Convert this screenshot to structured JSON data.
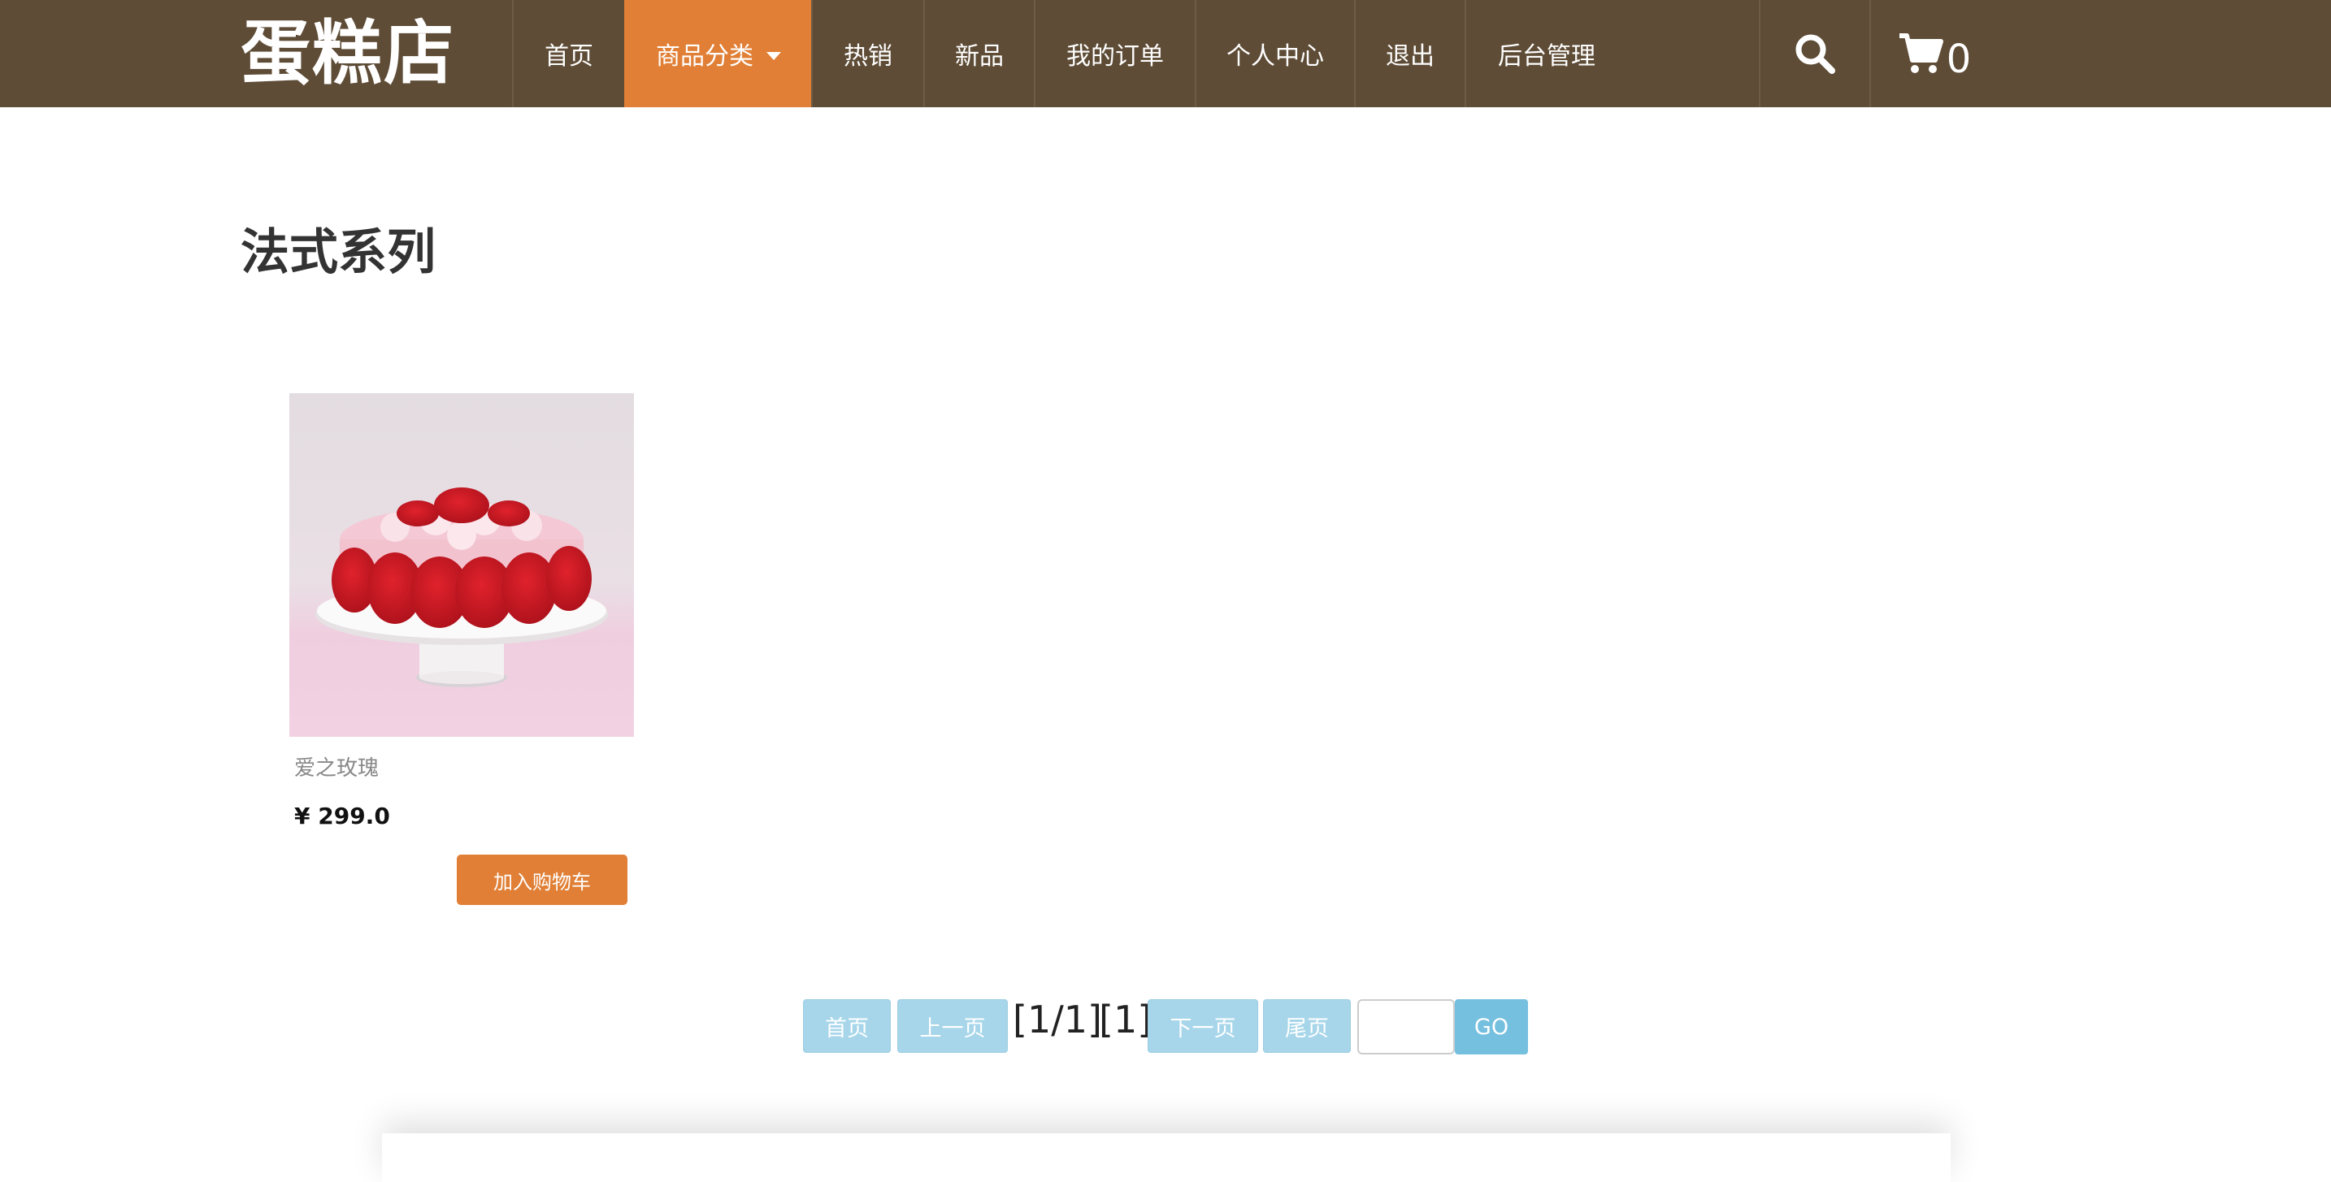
{
  "brand": {
    "logo_text": "蛋糕店"
  },
  "nav": {
    "items": [
      {
        "label": "首页"
      },
      {
        "label": "商品分类"
      },
      {
        "label": "热销"
      },
      {
        "label": "新品"
      },
      {
        "label": "我的订单"
      },
      {
        "label": "个人中心"
      },
      {
        "label": "退出"
      },
      {
        "label": "后台管理"
      }
    ],
    "active_index": 1,
    "cart_count": "0",
    "icons": {
      "search": "search-icon",
      "cart": "cart-icon",
      "dropdown": "caret-down-icon"
    }
  },
  "page": {
    "title": "法式系列"
  },
  "products": [
    {
      "name": "爱之玫瑰",
      "price": "¥ 299.0",
      "add_to_cart_label": "加入购物车"
    }
  ],
  "pagination": {
    "first_label": "首页",
    "prev_label": "上一页",
    "page_info": "[1/1]",
    "current_page": "[1]",
    "next_label": "下一页",
    "last_label": "尾页",
    "go_label": "GO",
    "jump_value": ""
  },
  "colors": {
    "nav_bg": "#5e4c36",
    "accent": "#e07f35",
    "pager_btn": "#a7d6ea",
    "pager_go": "#75bfdf"
  }
}
